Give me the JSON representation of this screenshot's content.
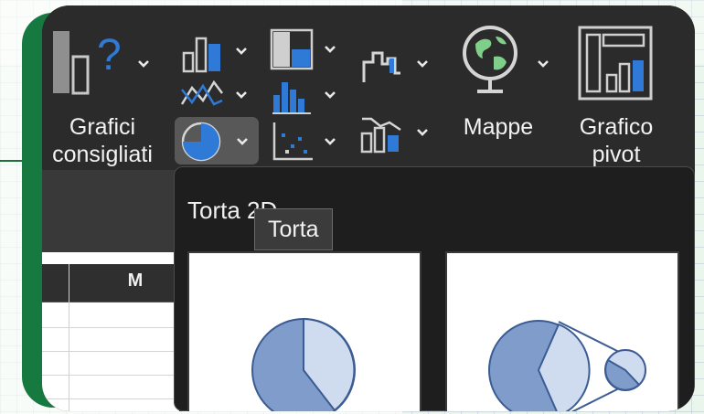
{
  "ribbon": {
    "recommended_charts": {
      "line1": "Grafici",
      "line2": "consigliati"
    },
    "maps": {
      "label": "Mappe"
    },
    "pivot_chart": {
      "line1": "Grafico",
      "line2": "pivot"
    },
    "question_glyph": "?"
  },
  "sheet": {
    "column_label": "M"
  },
  "dropdown": {
    "section_title": "Torta 2D"
  },
  "tooltip": {
    "text": "Torta"
  },
  "colors": {
    "accent_blue": "#2f7ad6",
    "frame_green": "#16793f",
    "pie_dark": "#7f9ccb",
    "pie_light": "#cfdcf0",
    "pie_stroke": "#3b5b93"
  }
}
